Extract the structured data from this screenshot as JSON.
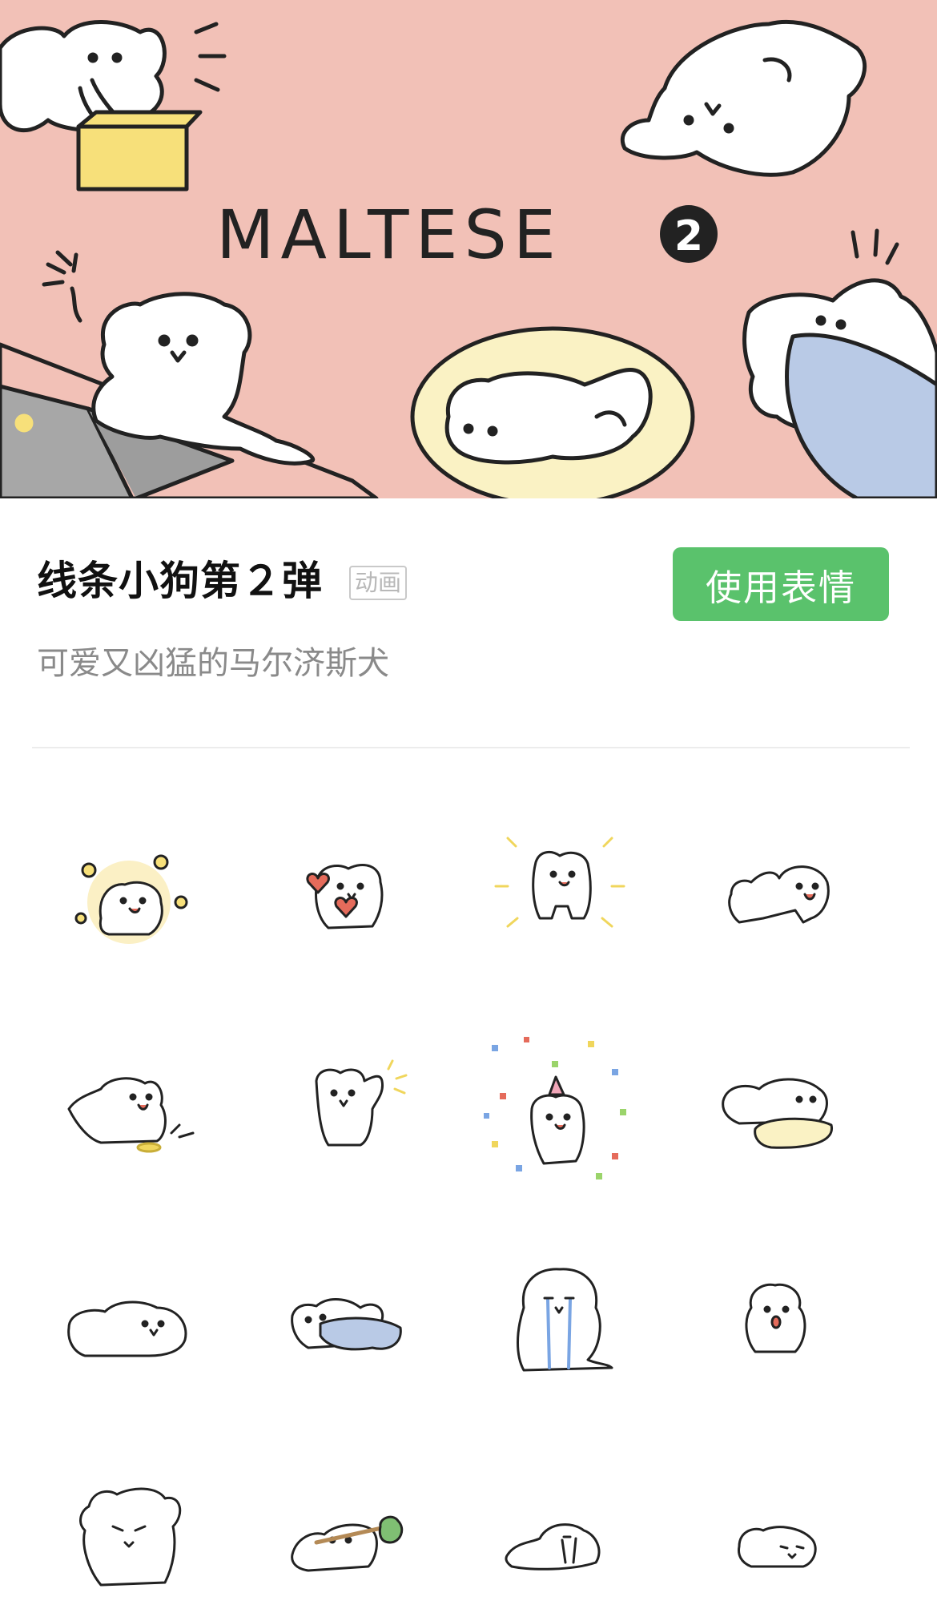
{
  "banner": {
    "logo_text": "MALTESE",
    "logo_number": "2",
    "colors": {
      "background": "#f2c1b7",
      "box": "#f7e07a",
      "cushion": "#faf2c4",
      "laptop": "#a7a7a7",
      "blanket": "#b9cae6"
    }
  },
  "pack": {
    "title": "线条小狗第２弹",
    "badge": "动画",
    "description": "可爱又凶猛的马尔济斯犬",
    "use_button_label": "使用表情",
    "button_color": "#5ac26c"
  },
  "stickers": [
    {
      "icon": "dog-flowers-sticker"
    },
    {
      "icon": "dog-hearts-sticker"
    },
    {
      "icon": "dog-shining-sticker"
    },
    {
      "icon": "dog-crawl-sticker"
    },
    {
      "icon": "dog-pee-sticker"
    },
    {
      "icon": "dog-wave-sticker"
    },
    {
      "icon": "dog-party-sticker"
    },
    {
      "icon": "dog-pillow-sticker"
    },
    {
      "icon": "dog-lying-sticker"
    },
    {
      "icon": "dog-blanket-sticker"
    },
    {
      "icon": "dog-crying-sticker"
    },
    {
      "icon": "dog-sitting-sticker"
    },
    {
      "icon": "dog-angry-sticker"
    },
    {
      "icon": "dog-bindle-sticker"
    },
    {
      "icon": "dog-sleeping-sticker"
    },
    {
      "icon": "dog-nap-sticker"
    }
  ]
}
